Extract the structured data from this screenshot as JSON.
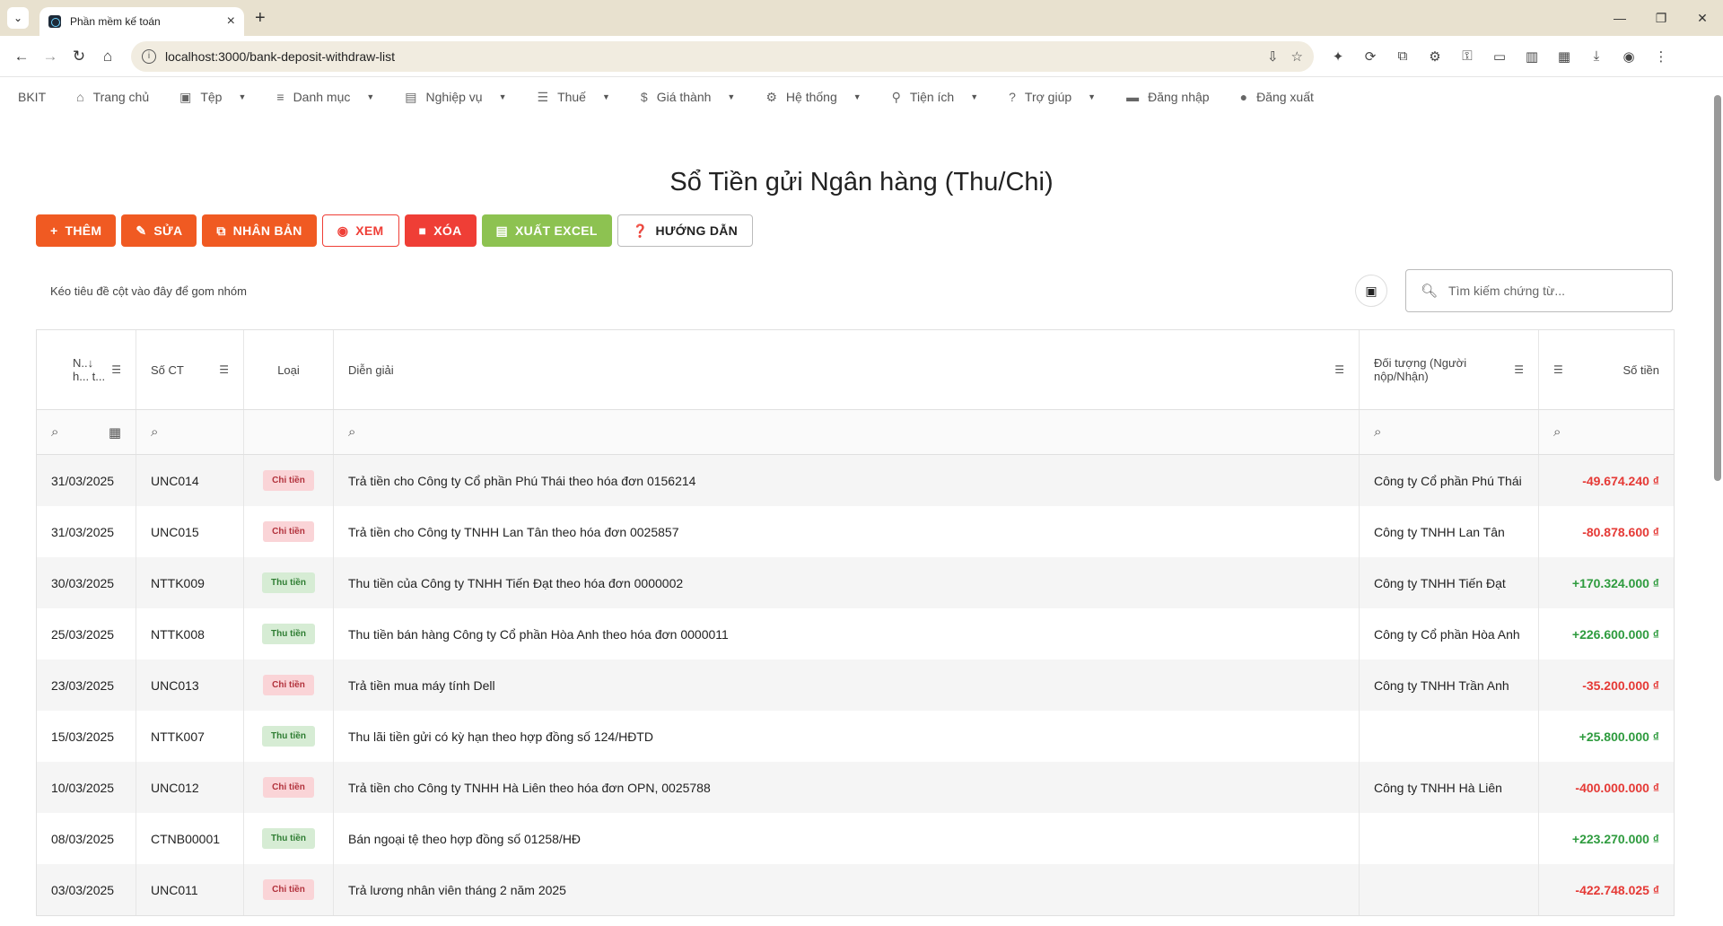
{
  "browser": {
    "tab_title": "Phần mềm kế toán",
    "url": "localhost:3000/bank-deposit-withdraw-list"
  },
  "menu": {
    "brand": "BKIT",
    "items": [
      {
        "label": "Trang chủ",
        "icon": "home-icon",
        "caret": false
      },
      {
        "label": "Tệp",
        "icon": "save-icon",
        "caret": true
      },
      {
        "label": "Danh mục",
        "icon": "list-icon",
        "caret": true
      },
      {
        "label": "Nghiệp vụ",
        "icon": "business-icon",
        "caret": true
      },
      {
        "label": "Thuế",
        "icon": "checklist-icon",
        "caret": true
      },
      {
        "label": "Giá thành",
        "icon": "dollar-icon",
        "caret": true
      },
      {
        "label": "Hệ thống",
        "icon": "gear-icon",
        "caret": true
      },
      {
        "label": "Tiện ích",
        "icon": "run-icon",
        "caret": true
      },
      {
        "label": "Trợ giúp",
        "icon": "help-icon",
        "caret": true
      },
      {
        "label": "Đăng nhập",
        "icon": "login-icon",
        "caret": false
      },
      {
        "label": "Đăng xuất",
        "icon": "logout-icon",
        "caret": false
      }
    ]
  },
  "page_title": "Sổ Tiền gửi Ngân hàng (Thu/Chi)",
  "toolbar": {
    "add": "THÊM",
    "edit": "SỬA",
    "duplicate": "NHÂN BẢN",
    "view": "XEM",
    "delete": "XÓA",
    "export": "XUẤT EXCEL",
    "guide": "HƯỚNG DẪN"
  },
  "group_hint": "Kéo tiêu đề cột vào đây để gom nhóm",
  "search_placeholder": "Tìm kiếm chứng từ...",
  "columns": {
    "date": "N..↓ h... t...",
    "doc_no": "Số CT",
    "type": "Loại",
    "description": "Diễn giải",
    "party": "Đối tượng (Người nộp/Nhận)",
    "amount": "Số tiền"
  },
  "rows": [
    {
      "date": "31/03/2025",
      "doc": "UNC014",
      "type": "Chi tiền",
      "kind": "chi",
      "desc": "Trả tiền cho Công ty Cổ phần Phú Thái theo hóa đơn 0156214",
      "party": "Công ty Cổ phần Phú Thái",
      "amount": "-49.674.240 ₫"
    },
    {
      "date": "31/03/2025",
      "doc": "UNC015",
      "type": "Chi tiền",
      "kind": "chi",
      "desc": "Trả tiền cho Công ty TNHH Lan Tân theo hóa đơn 0025857",
      "party": "Công ty TNHH Lan Tân",
      "amount": "-80.878.600 ₫"
    },
    {
      "date": "30/03/2025",
      "doc": "NTTK009",
      "type": "Thu tiền",
      "kind": "thu",
      "desc": "Thu tiền của Công ty TNHH Tiến Đạt theo hóa đơn 0000002",
      "party": "Công ty TNHH Tiến Đạt",
      "amount": "+170.324.000 ₫"
    },
    {
      "date": "25/03/2025",
      "doc": "NTTK008",
      "type": "Thu tiền",
      "kind": "thu",
      "desc": "Thu tiền bán hàng Công ty Cổ phần Hòa Anh theo hóa đơn 0000011",
      "party": "Công ty Cổ phần Hòa Anh",
      "amount": "+226.600.000 ₫"
    },
    {
      "date": "23/03/2025",
      "doc": "UNC013",
      "type": "Chi tiền",
      "kind": "chi",
      "desc": "Trả tiền mua máy tính Dell",
      "party": "Công ty TNHH Trần Anh",
      "amount": "-35.200.000 ₫"
    },
    {
      "date": "15/03/2025",
      "doc": "NTTK007",
      "type": "Thu tiền",
      "kind": "thu",
      "desc": "Thu lãi tiền gửi có kỳ hạn theo hợp đồng số 124/HĐTD",
      "party": "",
      "amount": "+25.800.000 ₫"
    },
    {
      "date": "10/03/2025",
      "doc": "UNC012",
      "type": "Chi tiền",
      "kind": "chi",
      "desc": "Trả tiền cho Công ty TNHH Hà Liên theo hóa đơn OPN, 0025788",
      "party": "Công ty TNHH Hà Liên",
      "amount": "-400.000.000 ₫"
    },
    {
      "date": "08/03/2025",
      "doc": "CTNB00001",
      "type": "Thu tiền",
      "kind": "thu",
      "desc": "Bán ngoại tệ theo hợp đồng số 01258/HĐ",
      "party": "",
      "amount": "+223.270.000 ₫"
    },
    {
      "date": "03/03/2025",
      "doc": "UNC011",
      "type": "Chi tiền",
      "kind": "chi",
      "desc": "Trả lương nhân viên tháng 2 năm 2025",
      "party": "",
      "amount": "-422.748.025 ₫"
    }
  ],
  "colors": {
    "primary": "#f05a22",
    "danger": "#ef3e36",
    "success": "#8dc251"
  }
}
